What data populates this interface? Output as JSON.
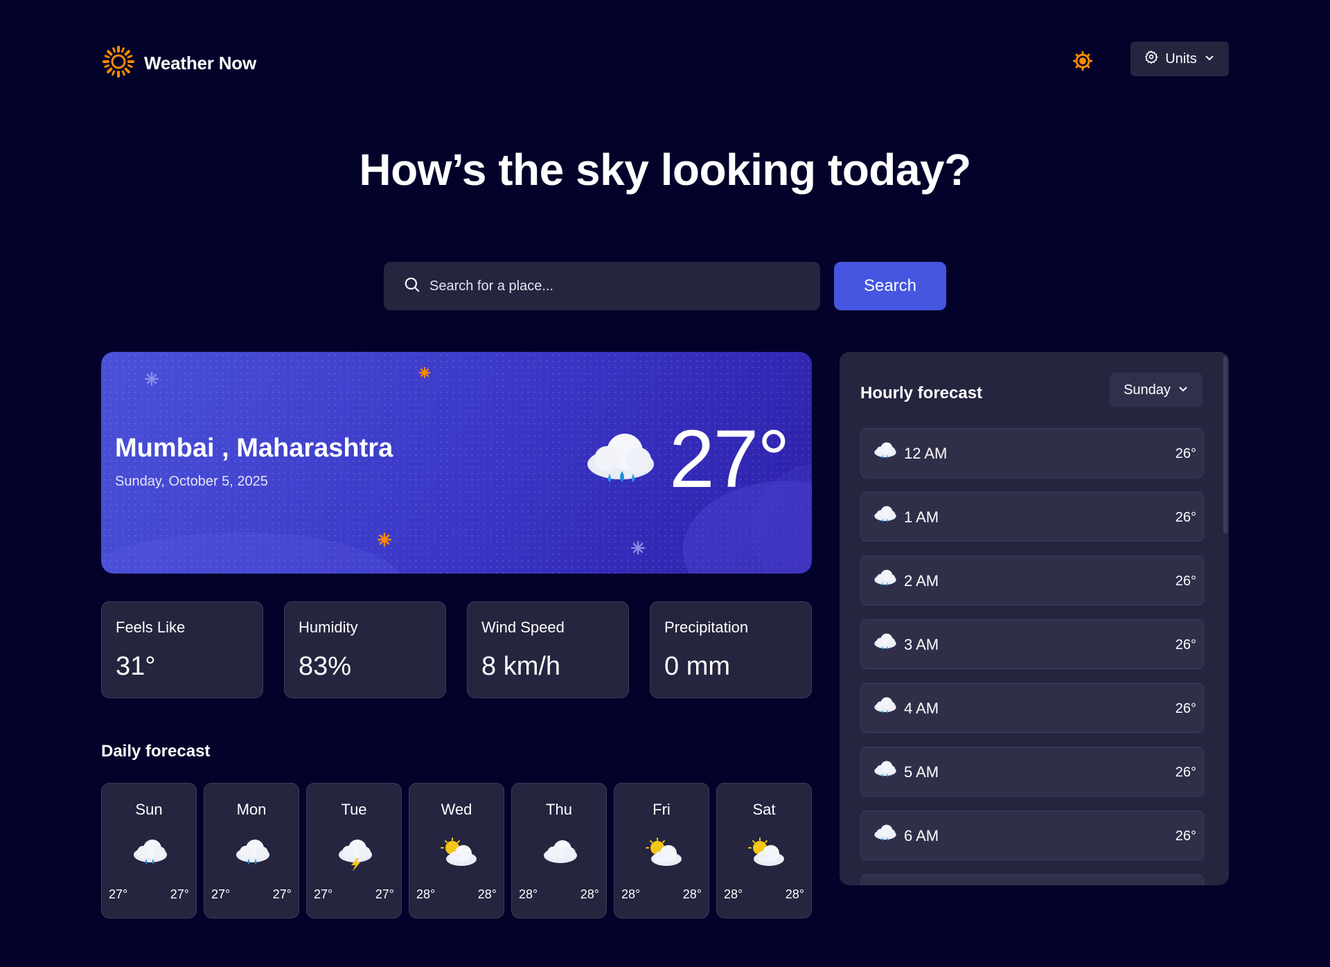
{
  "app": {
    "name": "Weather Now"
  },
  "header": {
    "theme_icon": "sun-gear-icon",
    "units_label": "Units"
  },
  "hero": {
    "title": "How’s the sky looking today?"
  },
  "search": {
    "placeholder": "Search for a place...",
    "button_label": "Search"
  },
  "current": {
    "location": "Mumbai , Maharashtra",
    "date": "Sunday, October 5, 2025",
    "temperature": "27°",
    "condition_icon": "rain-cloud-icon"
  },
  "stats": [
    {
      "label": "Feels Like",
      "value": "31°"
    },
    {
      "label": "Humidity",
      "value": "83%"
    },
    {
      "label": "Wind Speed",
      "value": "8 km/h"
    },
    {
      "label": "Precipitation",
      "value": "0 mm"
    }
  ],
  "daily": {
    "title": "Daily forecast",
    "days": [
      {
        "day": "Sun",
        "icon": "rain",
        "low": "27°",
        "high": "27°"
      },
      {
        "day": "Mon",
        "icon": "rain",
        "low": "27°",
        "high": "27°"
      },
      {
        "day": "Tue",
        "icon": "storm",
        "low": "27°",
        "high": "27°"
      },
      {
        "day": "Wed",
        "icon": "partly-cloudy",
        "low": "28°",
        "high": "28°"
      },
      {
        "day": "Thu",
        "icon": "cloudy",
        "low": "28°",
        "high": "28°"
      },
      {
        "day": "Fri",
        "icon": "partly-cloudy",
        "low": "28°",
        "high": "28°"
      },
      {
        "day": "Sat",
        "icon": "partly-cloudy",
        "low": "28°",
        "high": "28°"
      }
    ]
  },
  "hourly": {
    "title": "Hourly forecast",
    "selected_day": "Sunday",
    "hours": [
      {
        "time": "12 AM",
        "temp": "26°",
        "icon": "rain"
      },
      {
        "time": "1 AM",
        "temp": "26°",
        "icon": "rain"
      },
      {
        "time": "2 AM",
        "temp": "26°",
        "icon": "rain"
      },
      {
        "time": "3 AM",
        "temp": "26°",
        "icon": "rain"
      },
      {
        "time": "4 AM",
        "temp": "26°",
        "icon": "rain"
      },
      {
        "time": "5 AM",
        "temp": "26°",
        "icon": "rain"
      },
      {
        "time": "6 AM",
        "temp": "26°",
        "icon": "rain"
      }
    ]
  },
  "colors": {
    "background": "#03022a",
    "card": "#25253f",
    "accent": "#4656e0",
    "sun": "#ff8a00"
  }
}
